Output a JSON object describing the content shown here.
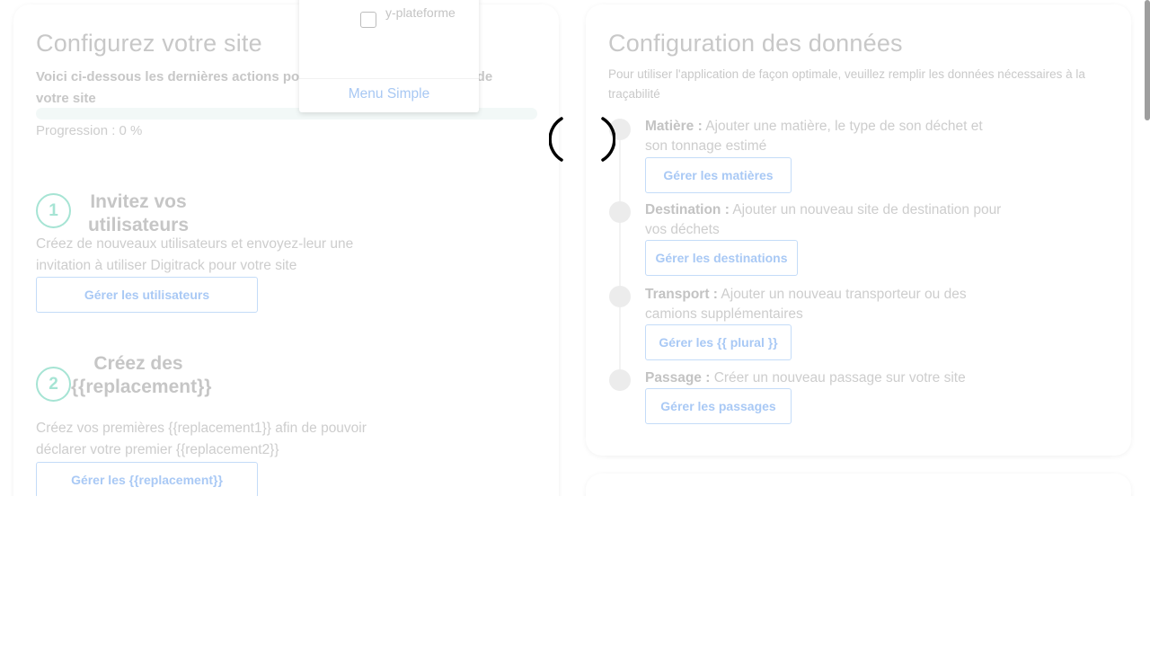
{
  "left": {
    "title": "Configurez votre site",
    "intro": "Voici ci-dessous les dernières actions pour finaliser la configuration de votre site",
    "progress_percent": 0,
    "progress_label": "Progression : 0 %",
    "steps": [
      {
        "number": "1",
        "title": "Invitez vos utilisateurs",
        "description": "Créez de nouveaux utilisateurs et envoyez-leur une invitation à utiliser Digitrack pour votre site",
        "button": "Gérer les utilisateurs"
      },
      {
        "number": "2",
        "title": "Créez des {{replacement}}",
        "description": "Créez vos premières {{replacement1}} afin de pouvoir déclarer votre premier {{replacement2}}",
        "button": "Gérer les {{replacement}}"
      }
    ]
  },
  "right": {
    "title": "Configuration des données",
    "subtitle": "Pour utiliser l'application de façon optimale, veuillez remplir les données nécessaires à la traçabilité",
    "items": [
      {
        "label": "Matière :",
        "text": "Ajouter une matière, le type de son déchet et son tonnage estimé",
        "button": "Gérer les matières"
      },
      {
        "label": "Destination :",
        "text": "Ajouter un nouveau site de destination pour vos déchets",
        "button": "Gérer les destinations"
      },
      {
        "label": "Transport :",
        "text": "Ajouter un nouveau transporteur ou des camions supplémentaires",
        "button": "Gérer les {{ plural }}"
      },
      {
        "label": "Passage :",
        "text": "Créer un nouveau passage sur votre site",
        "button": "Gérer les passages"
      }
    ]
  },
  "dropdown": {
    "option_label": "y-plateforme",
    "option_checked": false,
    "menu_label": "Menu Simple"
  },
  "colors": {
    "accent_teal": "#a6e4d4",
    "button_blue": "#a9c9f5",
    "muted_text": "#c8c8c8"
  },
  "icons": {
    "spinner": "loading-spinner-icon",
    "checkbox": "checkbox-icon"
  }
}
